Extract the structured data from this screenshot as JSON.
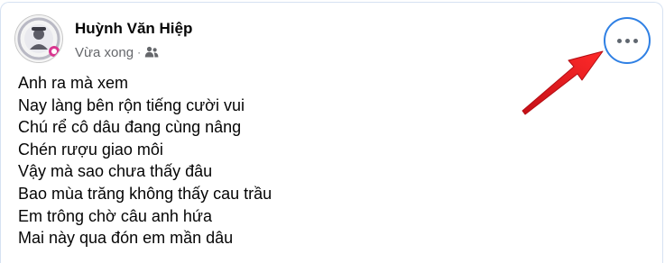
{
  "post": {
    "author_name": "Huỳnh Văn Hiệp",
    "timestamp": "Vừa xong",
    "separator": "·",
    "audience_icon": "friends-icon",
    "more_icon": "more-horizontal-icon",
    "lines": [
      "Anh ra mà xem",
      "Nay làng bên rộn tiếng cười vui",
      "Chú rể cô dâu đang cùng nâng",
      "Chén rượu giao môi",
      "Vậy mà sao chưa thấy đâu",
      "Bao mùa trăng không thấy cau trầu",
      "Em trông chờ câu anh hứa",
      "Mai này qua đón em mần dâu"
    ]
  },
  "colors": {
    "highlight_circle": "#2f80e4",
    "annotation_arrow": "#e8141b"
  }
}
